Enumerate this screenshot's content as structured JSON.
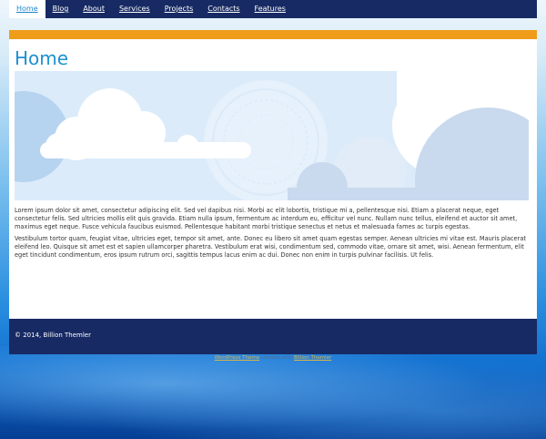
{
  "nav": {
    "items": [
      {
        "label": "Home",
        "active": true
      },
      {
        "label": "Blog"
      },
      {
        "label": "About"
      },
      {
        "label": "Services"
      },
      {
        "label": "Projects"
      },
      {
        "label": "Contacts"
      },
      {
        "label": "Features"
      }
    ]
  },
  "main": {
    "title": "Home",
    "paragraphs": [
      "Lorem ipsum dolor sit amet, consectetur adipiscing elit. Sed vel dapibus nisi. Morbi ac elit lobortis, tristique mi a, pellentesque nisi. Etiam a placerat neque, eget consectetur felis. Sed ultricies mollis elit quis gravida. Etiam nulla ipsum, fermentum ac interdum eu, efficitur vel nunc. Nullam nunc tellus, eleifend et auctor sit amet, maximus eget neque. Fusce vehicula faucibus euismod. Pellentesque habitant morbi tristique senectus et netus et malesuada fames ac turpis egestas.",
      "Vestibulum tortor quam, feugiat vitae, ultricies eget, tempor sit amet, ante. Donec eu libero sit amet quam egestas semper. Aenean ultricies mi vitae est. Mauris placerat eleifend leo. Quisque sit amet est et sapien ullamcorper pharetra. Vestibulum erat wisi, condimentum sed, commodo vitae, ornare sit amet, wisi. Aenean fermentum, elit eget tincidunt condimentum, eros ipsum rutrum orci, sagittis tempus lacus enim ac dui. Donec non enim in turpis pulvinar facilisis. Ut felis."
    ]
  },
  "footer": {
    "copyright": "© 2014, Billion Themler"
  },
  "credit": {
    "theme_link": "WordPress Theme",
    "middle": " created with ",
    "maker_link": "Billion Themler"
  },
  "colors": {
    "nav_bg": "#172a63",
    "accent_bar": "#ee9c1a",
    "title": "#1e90d2",
    "footer_bg": "#172a63"
  }
}
